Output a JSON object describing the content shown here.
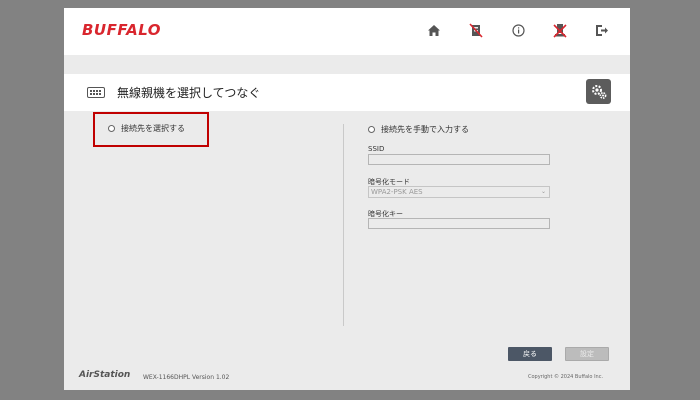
{
  "header": {
    "brand": "BUFFALO",
    "icons": [
      "home-icon",
      "wireless-off-icon",
      "info-icon",
      "disconnect-icon",
      "logout-icon"
    ]
  },
  "title_bar": {
    "title": "無線親機を選択してつなぐ",
    "icon": "keyboard-icon",
    "settings_icon": "gear-icon"
  },
  "left": {
    "option_label": "接続先を選択する"
  },
  "right": {
    "option_label": "接続先を手動で入力する",
    "ssid_label": "SSID",
    "ssid_value": "",
    "encryption_mode_label": "暗号化モード",
    "encryption_mode_value": "WPA2-PSK AES",
    "encryption_key_label": "暗号化キー",
    "encryption_key_value": ""
  },
  "buttons": {
    "back": "戻る",
    "apply": "設定"
  },
  "footer": {
    "product": "AirStation",
    "version": "WEX-1166DHPL Version 1.02",
    "copyright": "Copyright © 2024 Buffalo Inc."
  },
  "colors": {
    "brand_red": "#d9262e",
    "highlight_red": "#c00000",
    "back_button": "#4c5766",
    "background": "#828282"
  }
}
